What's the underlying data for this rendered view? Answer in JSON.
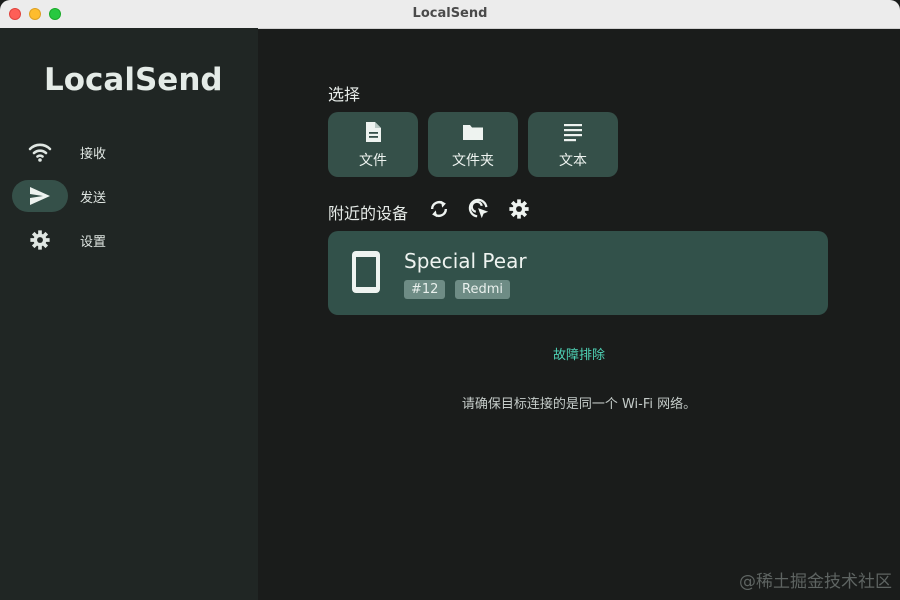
{
  "window": {
    "title": "LocalSend",
    "buttons": [
      "close",
      "minimize",
      "maximize"
    ]
  },
  "sidebar": {
    "app_name": "LocalSend",
    "items": [
      {
        "label": "接收",
        "icon": "wifi-icon",
        "active": false
      },
      {
        "label": "发送",
        "icon": "send-icon",
        "active": true
      },
      {
        "label": "设置",
        "icon": "gear-icon",
        "active": false
      }
    ]
  },
  "main": {
    "select_title": "选择",
    "select_buttons": [
      {
        "label": "文件",
        "icon": "file-icon"
      },
      {
        "label": "文件夹",
        "icon": "folder-icon"
      },
      {
        "label": "文本",
        "icon": "text-icon"
      }
    ],
    "nearby_title": "附近的设备",
    "nearby_actions": [
      "refresh-icon",
      "scan-target-icon",
      "settings-icon"
    ],
    "device": {
      "name": "Special Pear",
      "icon": "phone-icon",
      "tags": [
        "#12",
        "Redmi"
      ]
    },
    "troubleshoot_label": "故障排除",
    "hint_text": "请确保目标连接的是同一个 Wi-Fi 网络。"
  },
  "watermark": "@稀土掘金技术社区",
  "colors": {
    "sidebar_bg": "#202624",
    "main_bg": "#1a1c1b",
    "button_bg": "#355049",
    "card_bg": "#32514a",
    "badge_bg": "#6e8c85",
    "accent": "#4fd4b7"
  }
}
